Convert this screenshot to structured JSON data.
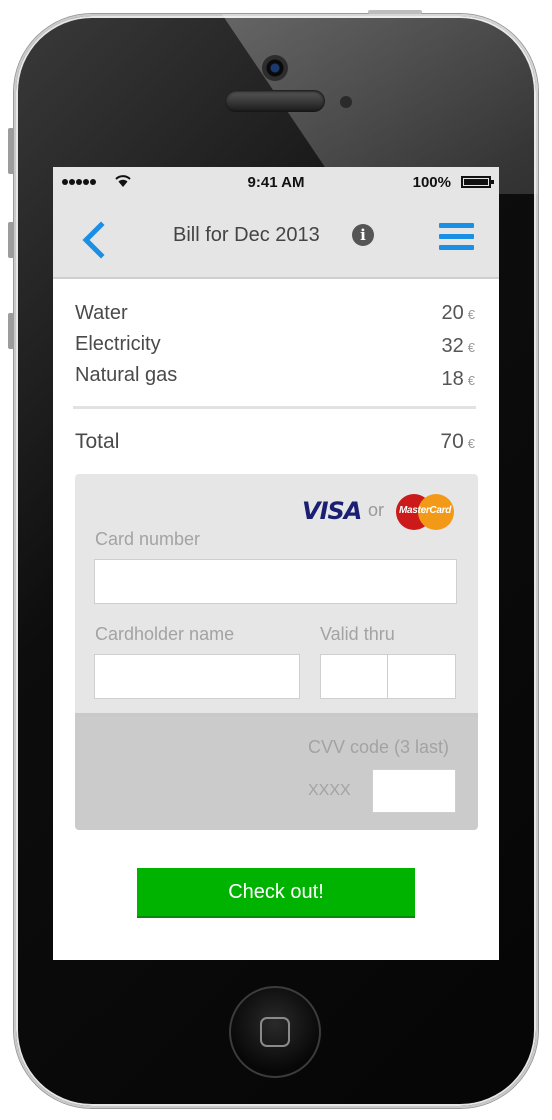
{
  "status_bar": {
    "time": "9:41 AM",
    "battery": "100%",
    "signal_icon": "signal-dots-icon",
    "wifi_icon": "wifi-icon",
    "battery_icon": "battery-icon"
  },
  "nav": {
    "back_icon": "chevron-left-icon",
    "title": "Bill for Dec 2013",
    "info_icon": "info-icon",
    "info_glyph": "i",
    "menu_icon": "hamburger-menu-icon",
    "accent_color": "#1a8fe6"
  },
  "bill": {
    "items": [
      {
        "name": "Water",
        "amount": "20",
        "currency": "€"
      },
      {
        "name": "Electricity",
        "amount": "32",
        "currency": "€"
      },
      {
        "name": "Natural gas",
        "amount": "18",
        "currency": "€"
      }
    ],
    "total_label": "Total",
    "total_amount": "70",
    "total_currency": "€"
  },
  "payment": {
    "visa_text": "VISA",
    "or_text": "or",
    "mastercard_text": "MasterCard",
    "card_number_label": "Card number",
    "card_number_value": "",
    "cardholder_label": "Cardholder name",
    "cardholder_value": "",
    "valid_thru_label": "Valid thru",
    "valid_month_value": "",
    "valid_year_value": "",
    "cvv_label": "CVV code (3 last)",
    "cvv_mask": "XXXX",
    "cvv_value": ""
  },
  "checkout": {
    "label": "Check out!",
    "color": "#00b300"
  }
}
